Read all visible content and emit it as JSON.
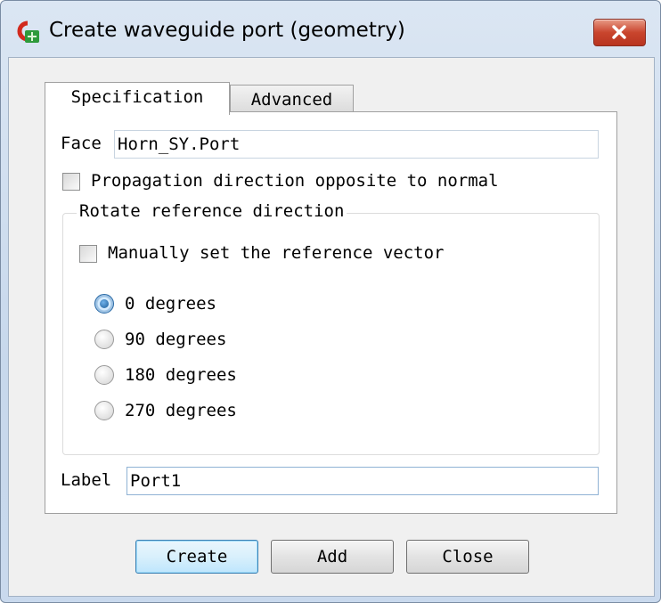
{
  "window": {
    "title": "Create waveguide port (geometry)"
  },
  "tabs": [
    {
      "label": "Specification",
      "selected": true
    },
    {
      "label": "Advanced",
      "selected": false
    }
  ],
  "form": {
    "face_label": "Face",
    "face_value": "Horn_SY.Port",
    "opposite_label": "Propagation direction opposite to normal",
    "opposite_checked": false,
    "rotate_group_title": "Rotate reference direction",
    "manual_label": "Manually set the reference vector",
    "manual_checked": false,
    "rotation_options": [
      {
        "label": "0 degrees",
        "selected": true
      },
      {
        "label": "90 degrees",
        "selected": false
      },
      {
        "label": "180 degrees",
        "selected": false
      },
      {
        "label": "270 degrees",
        "selected": false
      }
    ],
    "label_label": "Label",
    "label_value": "Port1"
  },
  "buttons": {
    "create": "Create",
    "add": "Add",
    "close": "Close"
  },
  "icons": {
    "app": "cst-app-icon",
    "close": "close-icon"
  },
  "colors": {
    "close_button": "#c9452d",
    "default_button_border": "#3c7fb1",
    "radio_selected": "#1d5d98"
  }
}
